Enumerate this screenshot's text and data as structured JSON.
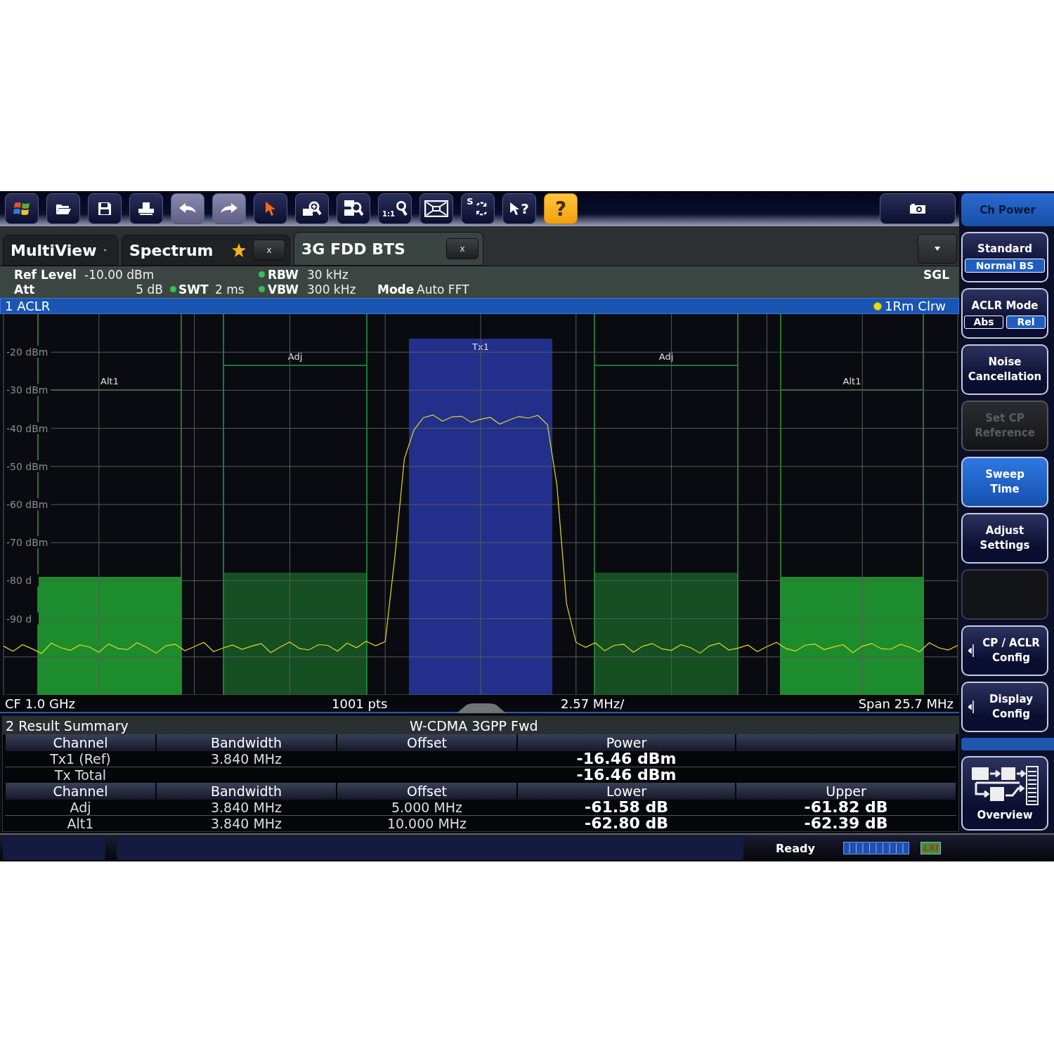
{
  "toolbar": [
    {
      "kind": "start"
    },
    {
      "kind": "open"
    },
    {
      "kind": "save"
    },
    {
      "kind": "print"
    },
    {
      "kind": "undo"
    },
    {
      "kind": "redo"
    },
    {
      "kind": "pointer"
    },
    {
      "kind": "zoom"
    },
    {
      "kind": "multi-zoom"
    },
    {
      "kind": "zoom-off",
      "text": "1:1"
    },
    {
      "kind": "full-screen"
    },
    {
      "kind": "sequencer",
      "text": "S"
    },
    {
      "kind": "pointer-help",
      "text": "?"
    },
    {
      "kind": "help",
      "text": "?"
    }
  ],
  "menu_title": "Ch Power",
  "tabs": [
    {
      "label": "MultiView",
      "kind": "overview",
      "selected": false,
      "modified": false
    },
    {
      "label": "Spectrum",
      "kind": "channel",
      "selected": false,
      "modified": true,
      "close": "x"
    },
    {
      "label": "3G FDD BTS",
      "kind": "channel",
      "selected": true,
      "modified": false,
      "close": "x"
    }
  ],
  "info": {
    "ref_level": {
      "label": "Ref Level",
      "value": "-10.00 dBm"
    },
    "att": {
      "label": "Att",
      "value": "5 dB"
    },
    "swt": {
      "label": "SWT",
      "value": "2 ms"
    },
    "rbw": {
      "label": "RBW",
      "value": "30 kHz"
    },
    "vbw": {
      "label": "VBW",
      "value": "300 kHz"
    },
    "mode": {
      "label": "Mode",
      "value": "Auto FFT"
    },
    "sweep": "SGL"
  },
  "diagram": {
    "title": "1 ACLR",
    "channels": [
      {
        "label": "Alt1",
        "kind": "alt"
      },
      {
        "label": "Adj",
        "kind": "adj"
      },
      {
        "label": "Tx1",
        "kind": "tx"
      },
      {
        "label": "Adj",
        "kind": "adj"
      },
      {
        "label": "Alt1",
        "kind": "alt"
      }
    ],
    "chart_data": {
      "type": "line",
      "grid": true,
      "ylim": [
        -110,
        -10
      ],
      "yticks": [
        {
          "value": -20,
          "label": "-20 dBm"
        },
        {
          "value": -30,
          "label": "-30 dBm"
        },
        {
          "value": -40,
          "label": "-40 dBm"
        },
        {
          "value": -50,
          "label": "-50 dBm"
        },
        {
          "value": -60,
          "label": "-60 dBm"
        },
        {
          "value": -70,
          "label": "-70 dBm"
        },
        {
          "value": -80,
          "label": "-80 d"
        },
        {
          "value": -90,
          "label": "-90 d"
        }
      ],
      "series": [
        {
          "name": "1Rm Clrw",
          "color": "#e8d820",
          "values": [
            -97.2,
            -98.5,
            -96.8,
            -97.9,
            -99.1,
            -96.4,
            -97.6,
            -98.3,
            -96.9,
            -97.4,
            -98.8,
            -96.6,
            -97.8,
            -98.1,
            -96.3,
            -97.5,
            -99.0,
            -97.1,
            -96.7,
            -98.4,
            -97.3,
            -96.2,
            -98.6,
            -97.7,
            -96.9,
            -98.0,
            -97.2,
            -96.5,
            -98.9,
            -97.4,
            -96.1,
            -97.8,
            -98.2,
            -96.8,
            -97.0,
            -98.5,
            -96.4,
            -97.6,
            -95.9,
            -97.1,
            -96.0,
            -74.0,
            -48.0,
            -40.5,
            -37.2,
            -36.5,
            -38.1,
            -37.0,
            -36.8,
            -38.4,
            -37.6,
            -37.1,
            -38.9,
            -37.8,
            -36.9,
            -37.3,
            -36.6,
            -39.0,
            -55.0,
            -86.0,
            -96.2,
            -97.5,
            -96.3,
            -98.4,
            -97.0,
            -96.7,
            -98.8,
            -97.2,
            -96.5,
            -97.9,
            -98.3,
            -96.8,
            -97.6,
            -99.0,
            -97.1,
            -96.4,
            -98.2,
            -97.7,
            -96.9,
            -98.6,
            -97.3,
            -96.2,
            -97.8,
            -98.5,
            -97.0,
            -96.6,
            -98.1,
            -97.4,
            -96.8,
            -98.9,
            -97.2,
            -96.5,
            -97.9,
            -98.0,
            -96.7,
            -97.5,
            -98.7,
            -96.3,
            -97.6,
            -98.2,
            -97.0
          ]
        }
      ]
    }
  },
  "footer": {
    "center_frequency": "CF 1.0 GHz",
    "points": "1001 pts",
    "per_division": "2.57 MHz/",
    "span": "Span 25.7 MHz"
  },
  "results": {
    "title": "2 Result Summary",
    "standard": "W-CDMA 3GPP Fwd",
    "sections": [
      {
        "columns": [
          {
            "label": "Channel",
            "kind": "param"
          },
          {
            "label": "Bandwidth",
            "kind": "param"
          },
          {
            "label": "Offset",
            "kind": "param"
          },
          {
            "label": "Power",
            "kind": "result"
          },
          {
            "kind": "result"
          }
        ],
        "rows": [
          [
            "Tx1 (Ref)",
            "3.840 MHz",
            null,
            "-16.46 dBm",
            null
          ],
          [
            "Tx Total",
            null,
            null,
            "-16.46 dBm",
            null
          ]
        ]
      },
      {
        "columns": [
          {
            "label": "Channel",
            "kind": "param"
          },
          {
            "label": "Bandwidth",
            "kind": "param"
          },
          {
            "label": "Offset",
            "kind": "param"
          },
          {
            "label": "Lower",
            "kind": "result"
          },
          {
            "label": "Upper",
            "kind": "result"
          }
        ],
        "rows": [
          [
            "Adj",
            "3.840 MHz",
            "5.000 MHz",
            "-61.58 dB",
            "-61.82 dB"
          ],
          [
            "Alt1",
            "3.840 MHz",
            "10.000 MHz",
            "-62.80 dB",
            "-62.39 dB"
          ]
        ]
      }
    ]
  },
  "softkeys": [
    {
      "kind": "value",
      "lines": [
        "Standard"
      ],
      "value": "Normal BS",
      "selected": false,
      "disabled": false
    },
    {
      "kind": "toggle",
      "lines": [
        "ACLR Mode"
      ],
      "options": [
        {
          "label": "Abs",
          "selected": false
        },
        {
          "label": "Rel",
          "selected": true
        }
      ],
      "selected": false,
      "disabled": false
    },
    {
      "kind": "plain",
      "lines": [
        "Noise",
        "Cancellation"
      ],
      "selected": false,
      "disabled": false
    },
    {
      "kind": "plain",
      "lines": [
        "Set CP",
        "Reference"
      ],
      "selected": false,
      "disabled": true
    },
    {
      "kind": "plain",
      "lines": [
        "Sweep",
        "Time"
      ],
      "selected": true,
      "disabled": false
    },
    {
      "kind": "plain",
      "lines": [
        "Adjust",
        "Settings"
      ],
      "selected": false,
      "disabled": false
    },
    {
      "kind": "empty",
      "selected": false,
      "disabled": false
    },
    {
      "kind": "submenu",
      "lines": [
        "CP / ACLR",
        "Config"
      ],
      "selected": false,
      "disabled": false
    },
    {
      "kind": "submenu",
      "lines": [
        "Display",
        "Config"
      ],
      "selected": false,
      "disabled": false
    }
  ],
  "overview": "Overview",
  "status": {
    "message": "Ready",
    "lxi": "LXI"
  }
}
